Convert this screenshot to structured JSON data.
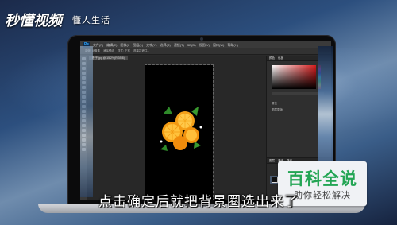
{
  "watermark": {
    "logo": "秒懂视频",
    "subtitle": "懂人生活"
  },
  "photoshop": {
    "logo": "Ps",
    "menu": [
      "文件(F)",
      "编辑(E)",
      "图像(I)",
      "图层(L)",
      "文字(Y)",
      "选择(S)",
      "滤镜(T)",
      "3D(D)",
      "视图(V)",
      "窗口(W)",
      "帮助(H)"
    ],
    "options": [
      "羽化: 0 像素",
      "消除锯齿",
      "样式: 正常",
      "选择并遮住..."
    ],
    "document_tab": "橙子.jpg @ 15.2%(RGB/8)",
    "panels": {
      "tabs": [
        "颜色",
        "色板"
      ],
      "properties": [
        "属性",
        "图层蒙版"
      ],
      "layers_tabs": [
        "图层",
        "通道",
        "路径"
      ],
      "layer_name": "图层 0"
    }
  },
  "badge": {
    "title": "百科全说",
    "subtitle": "助你轻松解决"
  },
  "subtitle": "点击确定后就把背景圈选出来了"
}
